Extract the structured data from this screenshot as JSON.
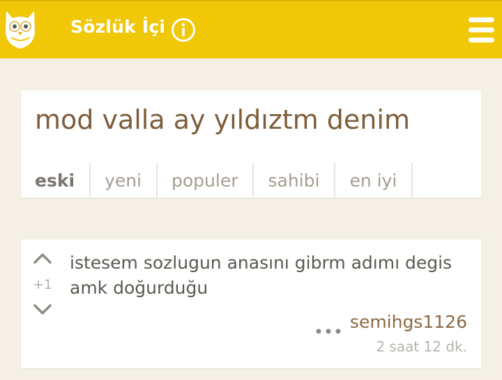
{
  "header": {
    "title": "Sözlük İçi",
    "logo_icon": "owl-logo-icon",
    "info_icon": "info-icon",
    "menu_icon": "hamburger-menu-icon",
    "background_color": "#f0c808"
  },
  "topic": {
    "title": "mod valla ay yıldıztm denim",
    "tabs": [
      {
        "label": "eski",
        "active": true
      },
      {
        "label": "yeni",
        "active": false
      },
      {
        "label": "populer",
        "active": false
      },
      {
        "label": "sahibi",
        "active": false
      },
      {
        "label": "en iyi",
        "active": false
      }
    ]
  },
  "entry": {
    "vote_count": "+1",
    "text_line1": "istesem sozlugun anasını gibrm adımı degis",
    "text_line2": "amk doğurduğu",
    "author": "semihgs1126",
    "time": "2 saat 12 dk."
  }
}
